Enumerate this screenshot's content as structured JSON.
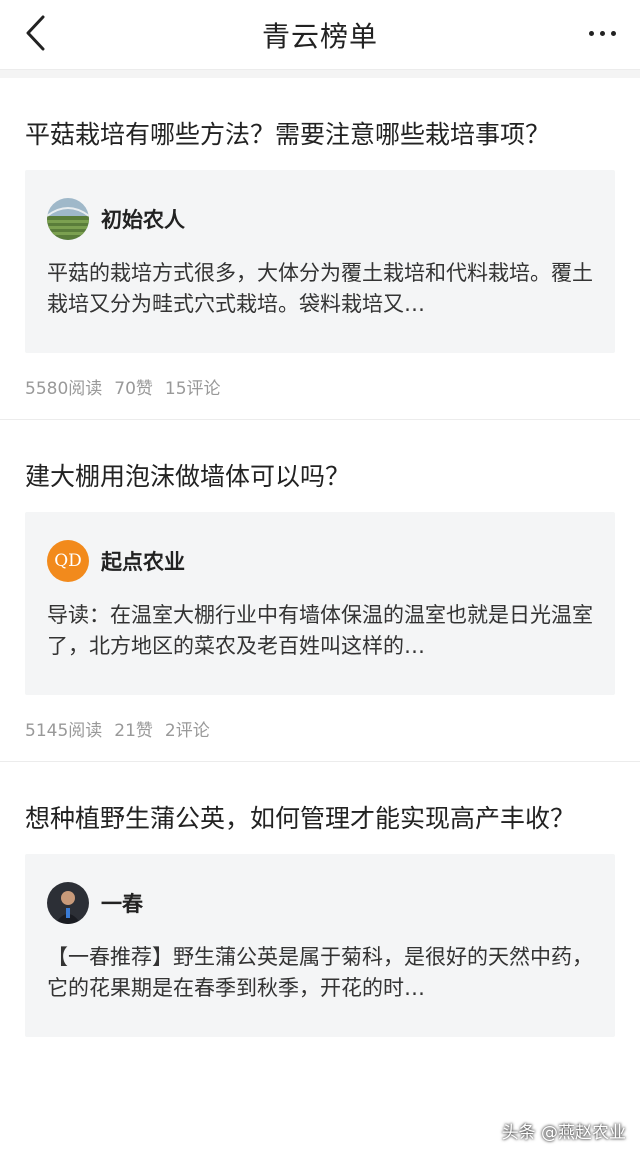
{
  "nav": {
    "title": "青云榜单"
  },
  "items": [
    {
      "title": "平菇栽培有哪些方法？需要注意哪些栽培事项？",
      "author": "初始农人",
      "excerpt": "平菇的栽培方式很多，大体分为覆土栽培和代料栽培。覆土栽培又分为畦式穴式栽培。袋料栽培又…",
      "reads": "5580阅读",
      "likes": "70赞",
      "comments": "15评论"
    },
    {
      "title": "建大棚用泡沫做墙体可以吗？",
      "author": "起点农业",
      "avatar_text": "QD",
      "excerpt": "导读：在温室大棚行业中有墙体保温的温室也就是日光温室了，北方地区的菜农及老百姓叫这样的…",
      "reads": "5145阅读",
      "likes": "21赞",
      "comments": "2评论"
    },
    {
      "title": "想种植野生蒲公英，如何管理才能实现高产丰收？",
      "author": "一春",
      "excerpt": "【一春推荐】野生蒲公英是属于菊科，是很好的天然中药，它的花果期是在春季到秋季，开花的时…"
    }
  ],
  "watermark": "头条 @燕赵农业"
}
